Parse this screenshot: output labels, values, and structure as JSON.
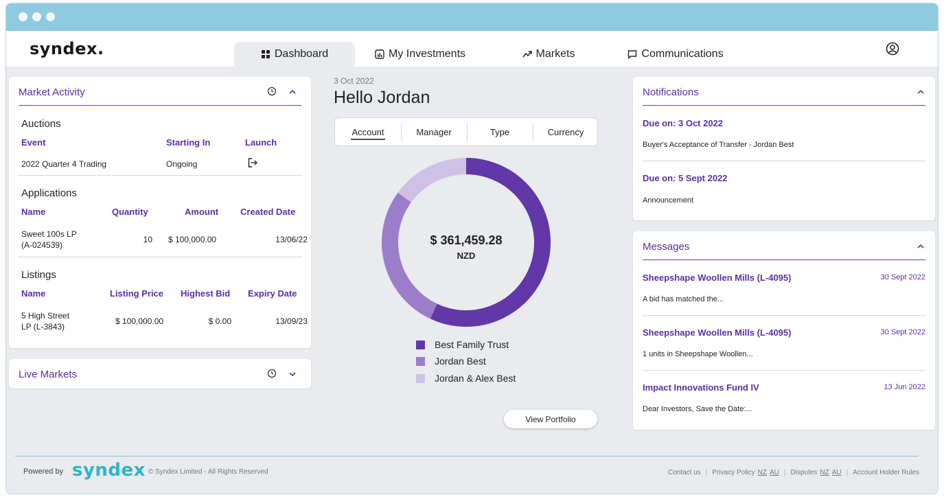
{
  "brand": {
    "logo": "syndex.",
    "accent": "#5b2fa6",
    "footer_logo": "syndex"
  },
  "nav": {
    "tabs": [
      {
        "label": "Dashboard",
        "icon": "grid-icon"
      },
      {
        "label": "My Investments",
        "icon": "bar-chart-icon"
      },
      {
        "label": "Markets",
        "icon": "trend-icon"
      },
      {
        "label": "Communications",
        "icon": "message-icon"
      }
    ]
  },
  "market_activity": {
    "title": "Market Activity",
    "auctions": {
      "title": "Auctions",
      "headers": [
        "Event",
        "Starting In",
        "Launch"
      ],
      "rows": [
        {
          "event": "2022 Quarter 4 Trading",
          "starting_in": "Ongoing"
        }
      ]
    },
    "applications": {
      "title": "Applications",
      "headers": [
        "Name",
        "Quantity",
        "Amount",
        "Created Date"
      ],
      "rows": [
        {
          "name_line1": "Sweet 100s LP",
          "name_line2": "(A-024539)",
          "quantity": "10",
          "amount": "$ 100,000.00",
          "created": "13/06/22"
        }
      ]
    },
    "listings": {
      "title": "Listings",
      "headers": [
        "Name",
        "Listing Price",
        "Highest Bid",
        "Expiry Date"
      ],
      "rows": [
        {
          "name_line1": "5 High Street",
          "name_line2": "LP (L-3843)",
          "price": "$ 100,000.00",
          "bid": "$ 0.00",
          "expiry": "13/09/23"
        }
      ]
    }
  },
  "live_markets": {
    "title": "Live Markets"
  },
  "greeting": {
    "date": "3 Oct 2022",
    "text": "Hello Jordan"
  },
  "segments": [
    "Account",
    "Manager",
    "Type",
    "Currency"
  ],
  "portfolio": {
    "total": "$ 361,459.28",
    "currency": "NZD",
    "view_button": "View Portfolio",
    "slices": [
      {
        "name": "Best Family Trust",
        "fraction": 0.57,
        "color": "#6237a8"
      },
      {
        "name": "Jordan Best",
        "fraction": 0.28,
        "color": "#9b7dc9"
      },
      {
        "name": "Jordan & Alex Best",
        "fraction": 0.15,
        "color": "#cfc1e6"
      }
    ]
  },
  "notifications": {
    "title": "Notifications",
    "items": [
      {
        "due": "Due on: 3 Oct 2022",
        "text": "Buyer's Acceptance of Transfer - Jordan Best"
      },
      {
        "due": "Due on: 5 Sept 2022",
        "text": "Announcement"
      }
    ]
  },
  "messages": {
    "title": "Messages",
    "items": [
      {
        "title": "Sheepshape Woollen Mills (L-4095)",
        "date": "30 Sept 2022",
        "text": "A bid has matched the..."
      },
      {
        "title": "Sheepshape Woollen Mills (L-4095)",
        "date": "30 Sept 2022",
        "text": "1 units in Sheepshape Woollen..."
      },
      {
        "title": "Impact Innovations Fund IV",
        "date": "13 Jun 2022",
        "text": "Dear Investors, Save the Date:..."
      }
    ]
  },
  "footer": {
    "powered_by": "Powered by",
    "copyright": "© Syndex Limited - All Rights Reserved",
    "contact": "Contact us",
    "privacy": "Privacy Policy",
    "nz": "NZ",
    "au": "AU",
    "disputes": "Disputes",
    "account_rules": "Account Holder Rules"
  }
}
